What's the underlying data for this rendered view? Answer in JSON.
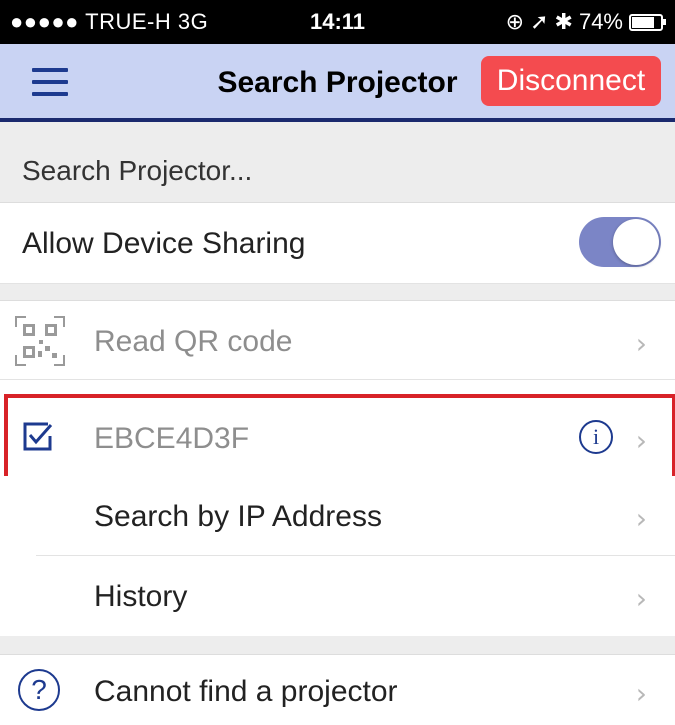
{
  "status_bar": {
    "carrier": "●●●●● TRUE-H  3G",
    "time": "14:11",
    "battery": "74%",
    "battery_level": 0.74
  },
  "navbar": {
    "title": "Search Projector",
    "disconnect_label": "Disconnect"
  },
  "section_header": "Search Projector...",
  "sharing": {
    "label": "Allow Device Sharing",
    "enabled": true
  },
  "rows": {
    "qr": {
      "label": "Read QR code",
      "icon": "qr-code-icon"
    },
    "device": {
      "label": "EBCE4D3F",
      "icon": "checkbox-checked-icon",
      "selected": true
    },
    "ip": {
      "label": "Search by IP Address"
    },
    "history": {
      "label": "History"
    },
    "help": {
      "label": "Cannot find a projector",
      "icon": "question-circle-icon"
    }
  },
  "chevron": "›",
  "colors": {
    "navbar_bg": "#c9d3f3",
    "accent": "#1d3a8f",
    "disconnect": "#f44b4f",
    "highlight": "#d82228",
    "toggle_on": "#7b85c6"
  }
}
